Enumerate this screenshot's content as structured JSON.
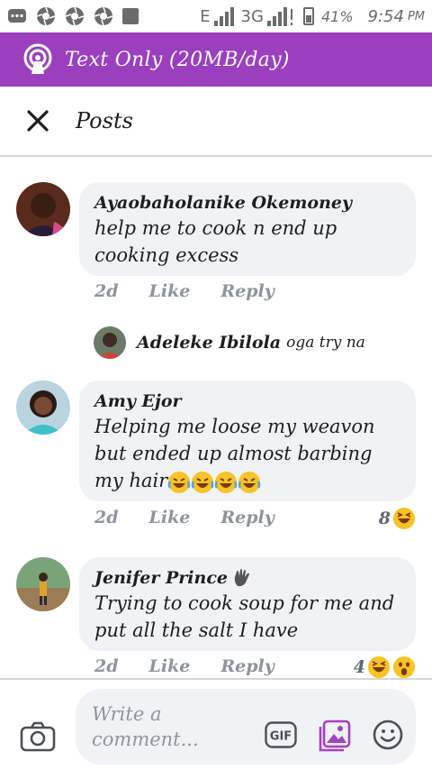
{
  "status_bar": {
    "network_e": "E",
    "network_3g": "3G",
    "battery": "41%",
    "time": "9:54",
    "ampm": "PM"
  },
  "banner": {
    "text": "Text Only (20MB/day)",
    "icon": "broadcast-icon"
  },
  "header": {
    "title": "Posts",
    "close_icon": "close-icon"
  },
  "comments": [
    {
      "author": "Ayaobaholanike Okemoney",
      "text": "help me to cook n end up cooking excess",
      "age": "2d",
      "like_label": "Like",
      "reply_label": "Reply",
      "reply": {
        "author": "Adeleke Ibilola",
        "text": "oga try na"
      }
    },
    {
      "author": "Amy Ejor",
      "text": "Helping me loose my weavon but ended up almost barbing my hair",
      "text_emojis": [
        "laugh-cry-emoji",
        "laugh-cry-emoji",
        "laugh-cry-emoji",
        "laugh-cry-emoji"
      ],
      "age": "2d",
      "like_label": "Like",
      "reply_label": "Reply",
      "reaction_count": "8",
      "reactions": [
        "haha-reaction-icon"
      ]
    },
    {
      "author": "Jenifer Prince",
      "author_badge": "waving-hand-icon",
      "text": "Trying to cook soup for  me and put all the salt I have",
      "age": "2d",
      "like_label": "Like",
      "reply_label": "Reply",
      "reaction_count": "4",
      "reactions": [
        "haha-reaction-icon",
        "wow-reaction-icon"
      ]
    }
  ],
  "composer": {
    "placeholder": "Write a comment...",
    "camera_icon": "camera-icon",
    "gif_label": "GIF",
    "photo_icon": "photo-icon",
    "emoji_icon": "smiley-icon"
  },
  "colors": {
    "banner": "#9b3fbf",
    "bubble": "#f0f2f5",
    "meta_text": "#8d949e"
  }
}
